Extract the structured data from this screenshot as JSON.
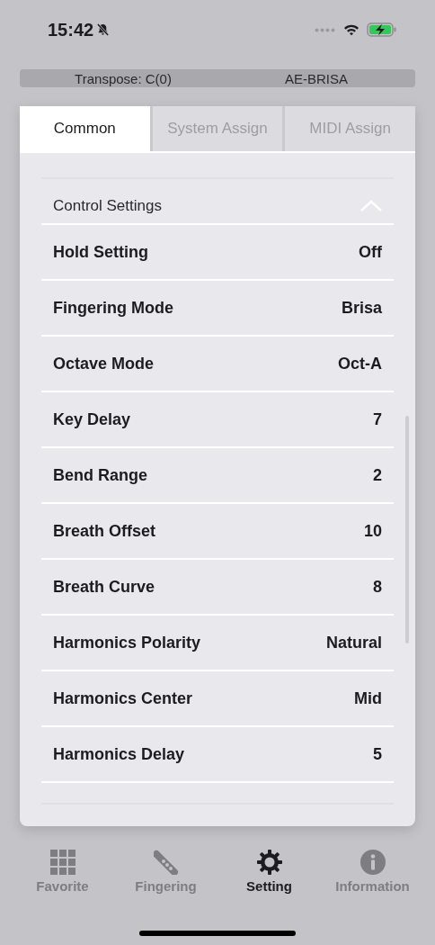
{
  "status_bar": {
    "time": "15:42"
  },
  "info_bar": {
    "transpose": "Transpose: C(0)",
    "model": "AE-BRISA"
  },
  "tabs": [
    {
      "label": "Common",
      "selected": true
    },
    {
      "label": "System Assign",
      "selected": false
    },
    {
      "label": "MIDI Assign",
      "selected": false
    }
  ],
  "section": {
    "title": "Control Settings",
    "expanded": true
  },
  "settings": [
    {
      "label": "Hold Setting",
      "value": "Off"
    },
    {
      "label": "Fingering Mode",
      "value": "Brisa"
    },
    {
      "label": "Octave Mode",
      "value": "Oct-A"
    },
    {
      "label": "Key Delay",
      "value": "7"
    },
    {
      "label": "Bend Range",
      "value": "2"
    },
    {
      "label": "Breath Offset",
      "value": "10"
    },
    {
      "label": "Breath Curve",
      "value": "8"
    },
    {
      "label": "Harmonics Polarity",
      "value": "Natural"
    },
    {
      "label": "Harmonics Center",
      "value": "Mid"
    },
    {
      "label": "Harmonics Delay",
      "value": "5"
    }
  ],
  "bottom_nav": [
    {
      "label": "Favorite",
      "kind": "grid",
      "selected": false
    },
    {
      "label": "Fingering",
      "kind": "fingering",
      "selected": false
    },
    {
      "label": "Setting",
      "kind": "gear",
      "selected": true
    },
    {
      "label": "Information",
      "kind": "info",
      "selected": false
    }
  ]
}
